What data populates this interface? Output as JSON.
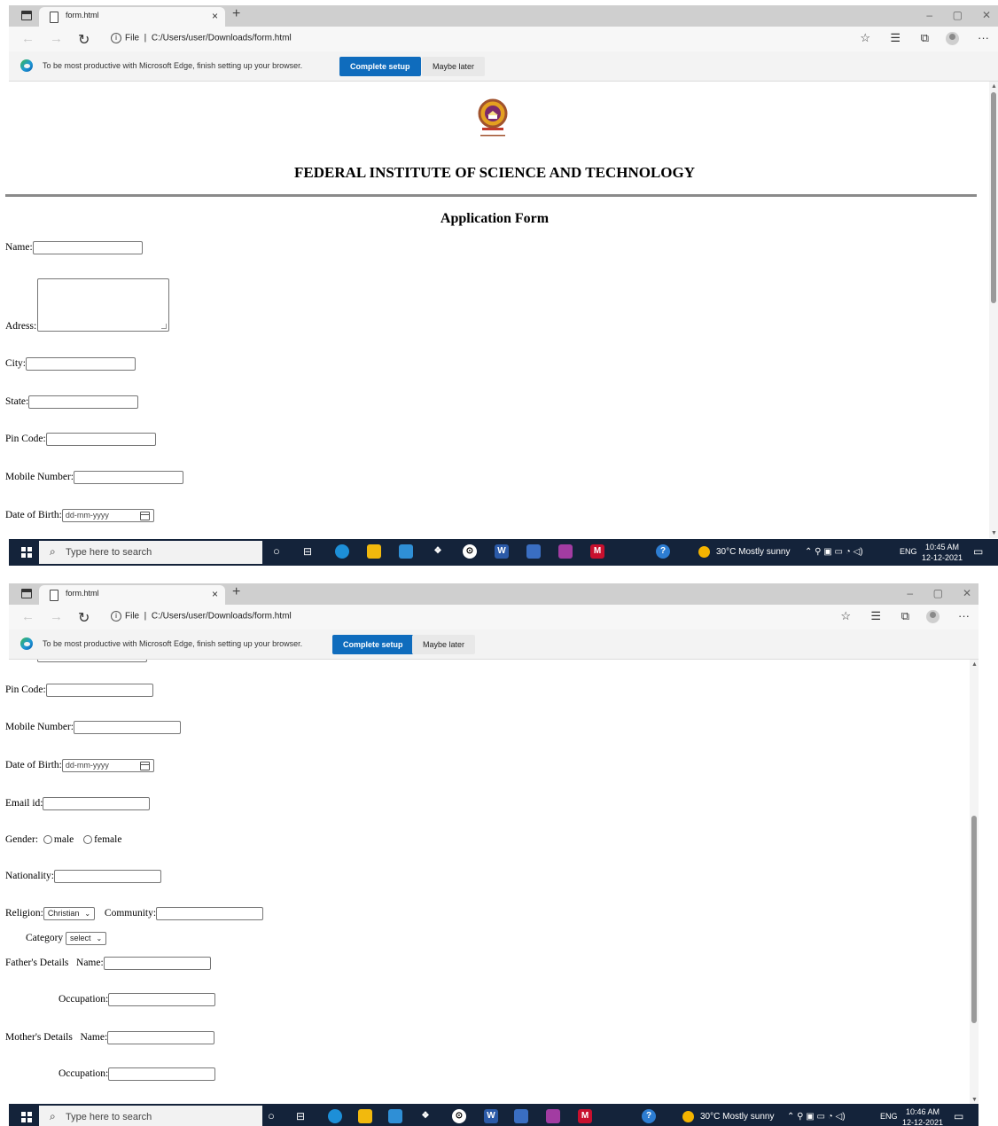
{
  "browser": {
    "tab_title": "form.html",
    "new_tab": "+",
    "close_tab": "×",
    "url_prefix": "File",
    "url": "C:/Users/user/Downloads/form.html",
    "win_min": "–",
    "win_max": "▢",
    "win_close": "✕",
    "more": "···"
  },
  "infobar": {
    "message": "To be most productive with Microsoft Edge, finish setting up your browser.",
    "primary": "Complete setup",
    "secondary": "Maybe later"
  },
  "page": {
    "institute": "FEDERAL INSTITUTE OF SCIENCE AND TECHNOLOGY",
    "heading": "Application Form",
    "labels": {
      "name": "Name:",
      "address": "Adress:",
      "city": "City:",
      "state": "State:",
      "pincode": "Pin Code:",
      "mobile": "Mobile Number:",
      "dob": "Date of Birth:",
      "email": "Email id:",
      "gender": "Gender:",
      "male": "male",
      "female": "female",
      "nationality": "Nationality:",
      "religion": "Religion:",
      "community": "Community:",
      "category": "Category",
      "father": "Father's Details",
      "mother": "Mother's Details",
      "parent_name": "Name:",
      "occupation": "Occupation:"
    },
    "dob_placeholder": "dd-mm-yyyy",
    "religion_selected": "Christian",
    "category_selected": "select"
  },
  "taskbar": {
    "search_placeholder": "Type here to search",
    "weather": "30°C  Mostly sunny",
    "lang": "ENG",
    "time1": "10:45 AM",
    "time2": "10:46 AM",
    "date": "12-12-2021"
  }
}
